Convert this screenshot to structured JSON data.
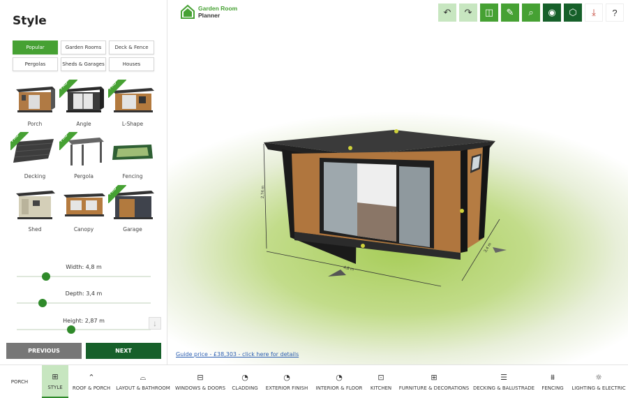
{
  "sidebar": {
    "title": "Style",
    "categories": [
      "Popular",
      "Garden Rooms",
      "Deck & Fence",
      "Pergolas",
      "Sheds & Garages",
      "Houses"
    ],
    "styles": [
      {
        "label": "Porch",
        "pro": false
      },
      {
        "label": "Angle",
        "pro": true
      },
      {
        "label": "L-Shape",
        "pro": true
      },
      {
        "label": "Decking",
        "pro": true
      },
      {
        "label": "Pergola",
        "pro": true
      },
      {
        "label": "Fencing",
        "pro": false
      },
      {
        "label": "Shed",
        "pro": false
      },
      {
        "label": "Canopy",
        "pro": false
      },
      {
        "label": "Garage",
        "pro": true
      }
    ],
    "pro_badge": "PRO",
    "width_label": "Width:  4,8  m",
    "depth_label": "Depth:  3,4  m",
    "height_label": "Height:  2,87  m",
    "previous_label": "PREVIOUS",
    "next_label": "NEXT"
  },
  "viewport": {
    "logo_line1": "Garden Room",
    "logo_line2": "Planner",
    "guide_price": "Guide price - £38,303 - click here for details",
    "dim_height": "2,74 m",
    "dim_width": "4,8 m",
    "dim_depth": "3,4 m"
  },
  "bottombar": {
    "items": [
      "PORCH",
      "STYLE",
      "ROOF & PORCH",
      "LAYOUT & BATHROOM",
      "WINDOWS & DOORS",
      "CLADDING",
      "EXTERIOR FINISH",
      "INTERIOR & FLOOR",
      "KITCHEN",
      "FURNITURE & DECORATIONS",
      "DECKING & BALUSTRADE",
      "FENCING",
      "LIGHTING & ELECTRIC"
    ]
  },
  "colors": {
    "accent": "#46a133",
    "dark_accent": "#16602a",
    "active_bg": "#c7e6c0"
  }
}
